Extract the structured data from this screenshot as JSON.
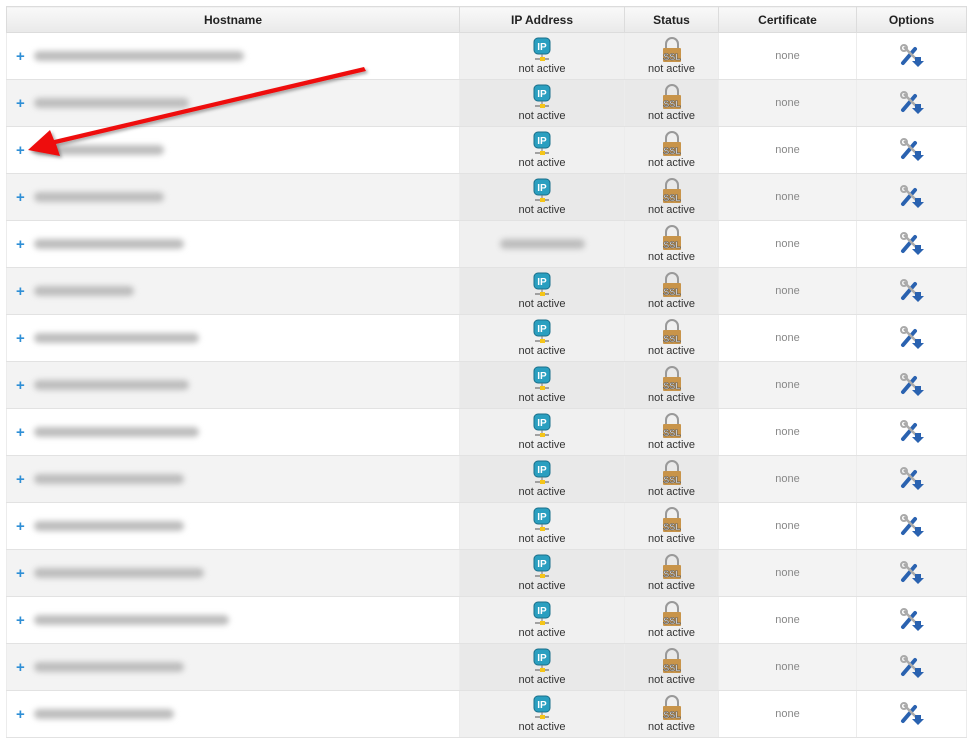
{
  "table": {
    "headers": [
      "Hostname",
      "IP Address",
      "Status",
      "Certificate",
      "Options"
    ],
    "rows": [
      {
        "hostname": "[redacted]",
        "ip": "not active",
        "ip_icon": true,
        "status": "not active",
        "certificate": "none"
      },
      {
        "hostname": "[redacted]",
        "ip": "not active",
        "ip_icon": true,
        "status": "not active",
        "certificate": "none"
      },
      {
        "hostname": "[redacted]",
        "ip": "not active",
        "ip_icon": true,
        "status": "not active",
        "certificate": "none"
      },
      {
        "hostname": "[redacted]",
        "ip": "not active",
        "ip_icon": true,
        "status": "not active",
        "certificate": "none"
      },
      {
        "hostname": "[redacted]",
        "ip": "[redacted IP]",
        "ip_icon": false,
        "status": "not active",
        "certificate": "none"
      },
      {
        "hostname": "[redacted]",
        "ip": "not active",
        "ip_icon": true,
        "status": "not active",
        "certificate": "none"
      },
      {
        "hostname": "[redacted]",
        "ip": "not active",
        "ip_icon": true,
        "status": "not active",
        "certificate": "none"
      },
      {
        "hostname": "[redacted]",
        "ip": "not active",
        "ip_icon": true,
        "status": "not active",
        "certificate": "none"
      },
      {
        "hostname": "[redacted]",
        "ip": "not active",
        "ip_icon": true,
        "status": "not active",
        "certificate": "none"
      },
      {
        "hostname": "[redacted]",
        "ip": "not active",
        "ip_icon": true,
        "status": "not active",
        "certificate": "none"
      },
      {
        "hostname": "[redacted]",
        "ip": "not active",
        "ip_icon": true,
        "status": "not active",
        "certificate": "none"
      },
      {
        "hostname": "[redacted]",
        "ip": "not active",
        "ip_icon": true,
        "status": "not active",
        "certificate": "none"
      },
      {
        "hostname": "[redacted]",
        "ip": "not active",
        "ip_icon": true,
        "status": "not active",
        "certificate": "none"
      },
      {
        "hostname": "[redacted]",
        "ip": "not active",
        "ip_icon": true,
        "status": "not active",
        "certificate": "none"
      },
      {
        "hostname": "[redacted]",
        "ip": "not active",
        "ip_icon": true,
        "status": "not active",
        "certificate": "none"
      }
    ]
  },
  "icons": {
    "expand": "+",
    "ip": "ip-icon",
    "ssl": "ssl-lock-icon",
    "options": "tools-icon"
  },
  "annotation": {
    "type": "red-arrow",
    "target_row": 3,
    "color": "#ee1111"
  },
  "colors": {
    "plus": "#2f8fd6",
    "ip_badge": "#2a9fc0",
    "lock": "#c8944a"
  }
}
